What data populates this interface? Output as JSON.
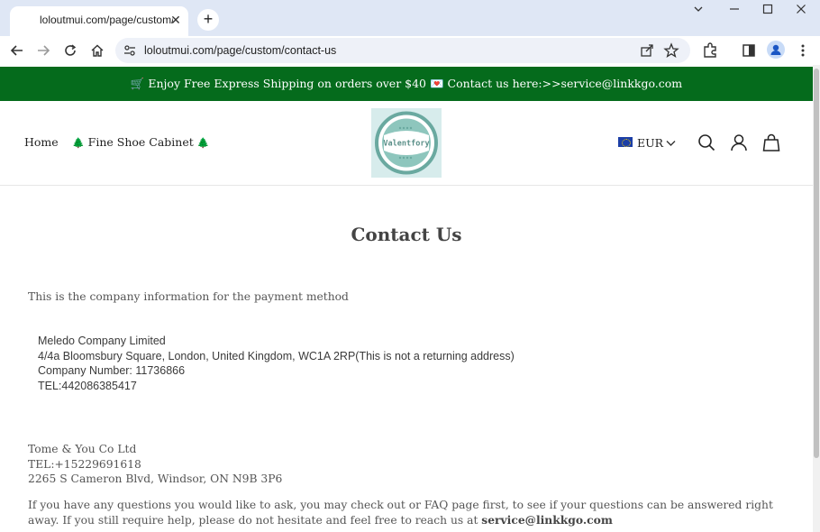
{
  "browser": {
    "tab_title": "loloutmui.com/page/custom/contact-us",
    "url": "loloutmui.com/page/custom/contact-us",
    "new_tab_glyph": "+",
    "close_glyph": "✕"
  },
  "announcement": {
    "text": "🛒 Enjoy Free Express Shipping on orders over $40 💌 Contact us here:>>service@linkkgo.com"
  },
  "nav": {
    "home": "Home",
    "cabinet_prefix": "🌲",
    "cabinet": " Fine Shoe Cabinet ",
    "cabinet_suffix": "🌲"
  },
  "logo": {
    "text": "Valentfory"
  },
  "currency": {
    "code": "EUR"
  },
  "page": {
    "title": "Contact Us",
    "intro": "This is the company information for the payment method",
    "company": {
      "name": "Meledo Company Limited",
      "address": "4/4a Bloomsbury Square, London, United Kingdom, WC1A 2RP(This is not a returning address)",
      "number": "Company Number:  11736866",
      "tel": "TEL:442086385417"
    },
    "second_company": {
      "name": "Tome & You Co Ltd",
      "tel": "TEL:+15229691618",
      "address": "2265 S Cameron Blvd, Windsor, ON N9B 3P6"
    },
    "help_text": "If you have any questions you would like to ask, you may check out or FAQ page first, to see if your questions can be answered right away. If you still require help, please do not hesitate and feel free to reach us at ",
    "help_email": "service@linkkgo.com"
  },
  "colors": {
    "announcement_bg": "#056b1c",
    "chrome_bg": "#dfe7f5",
    "logo_bg": "#d7ecec"
  },
  "icons": {
    "back": "arrow-left-icon",
    "forward": "arrow-right-icon",
    "reload": "reload-icon",
    "home": "home-icon",
    "site_info": "tune-icon",
    "share": "share-icon",
    "bookmark": "star-icon",
    "extensions": "puzzle-icon",
    "sidepanel": "side-panel-icon",
    "profile": "person-icon",
    "menu": "kebab-menu-icon",
    "search": "search-icon",
    "account": "user-icon",
    "cart": "bag-icon"
  }
}
